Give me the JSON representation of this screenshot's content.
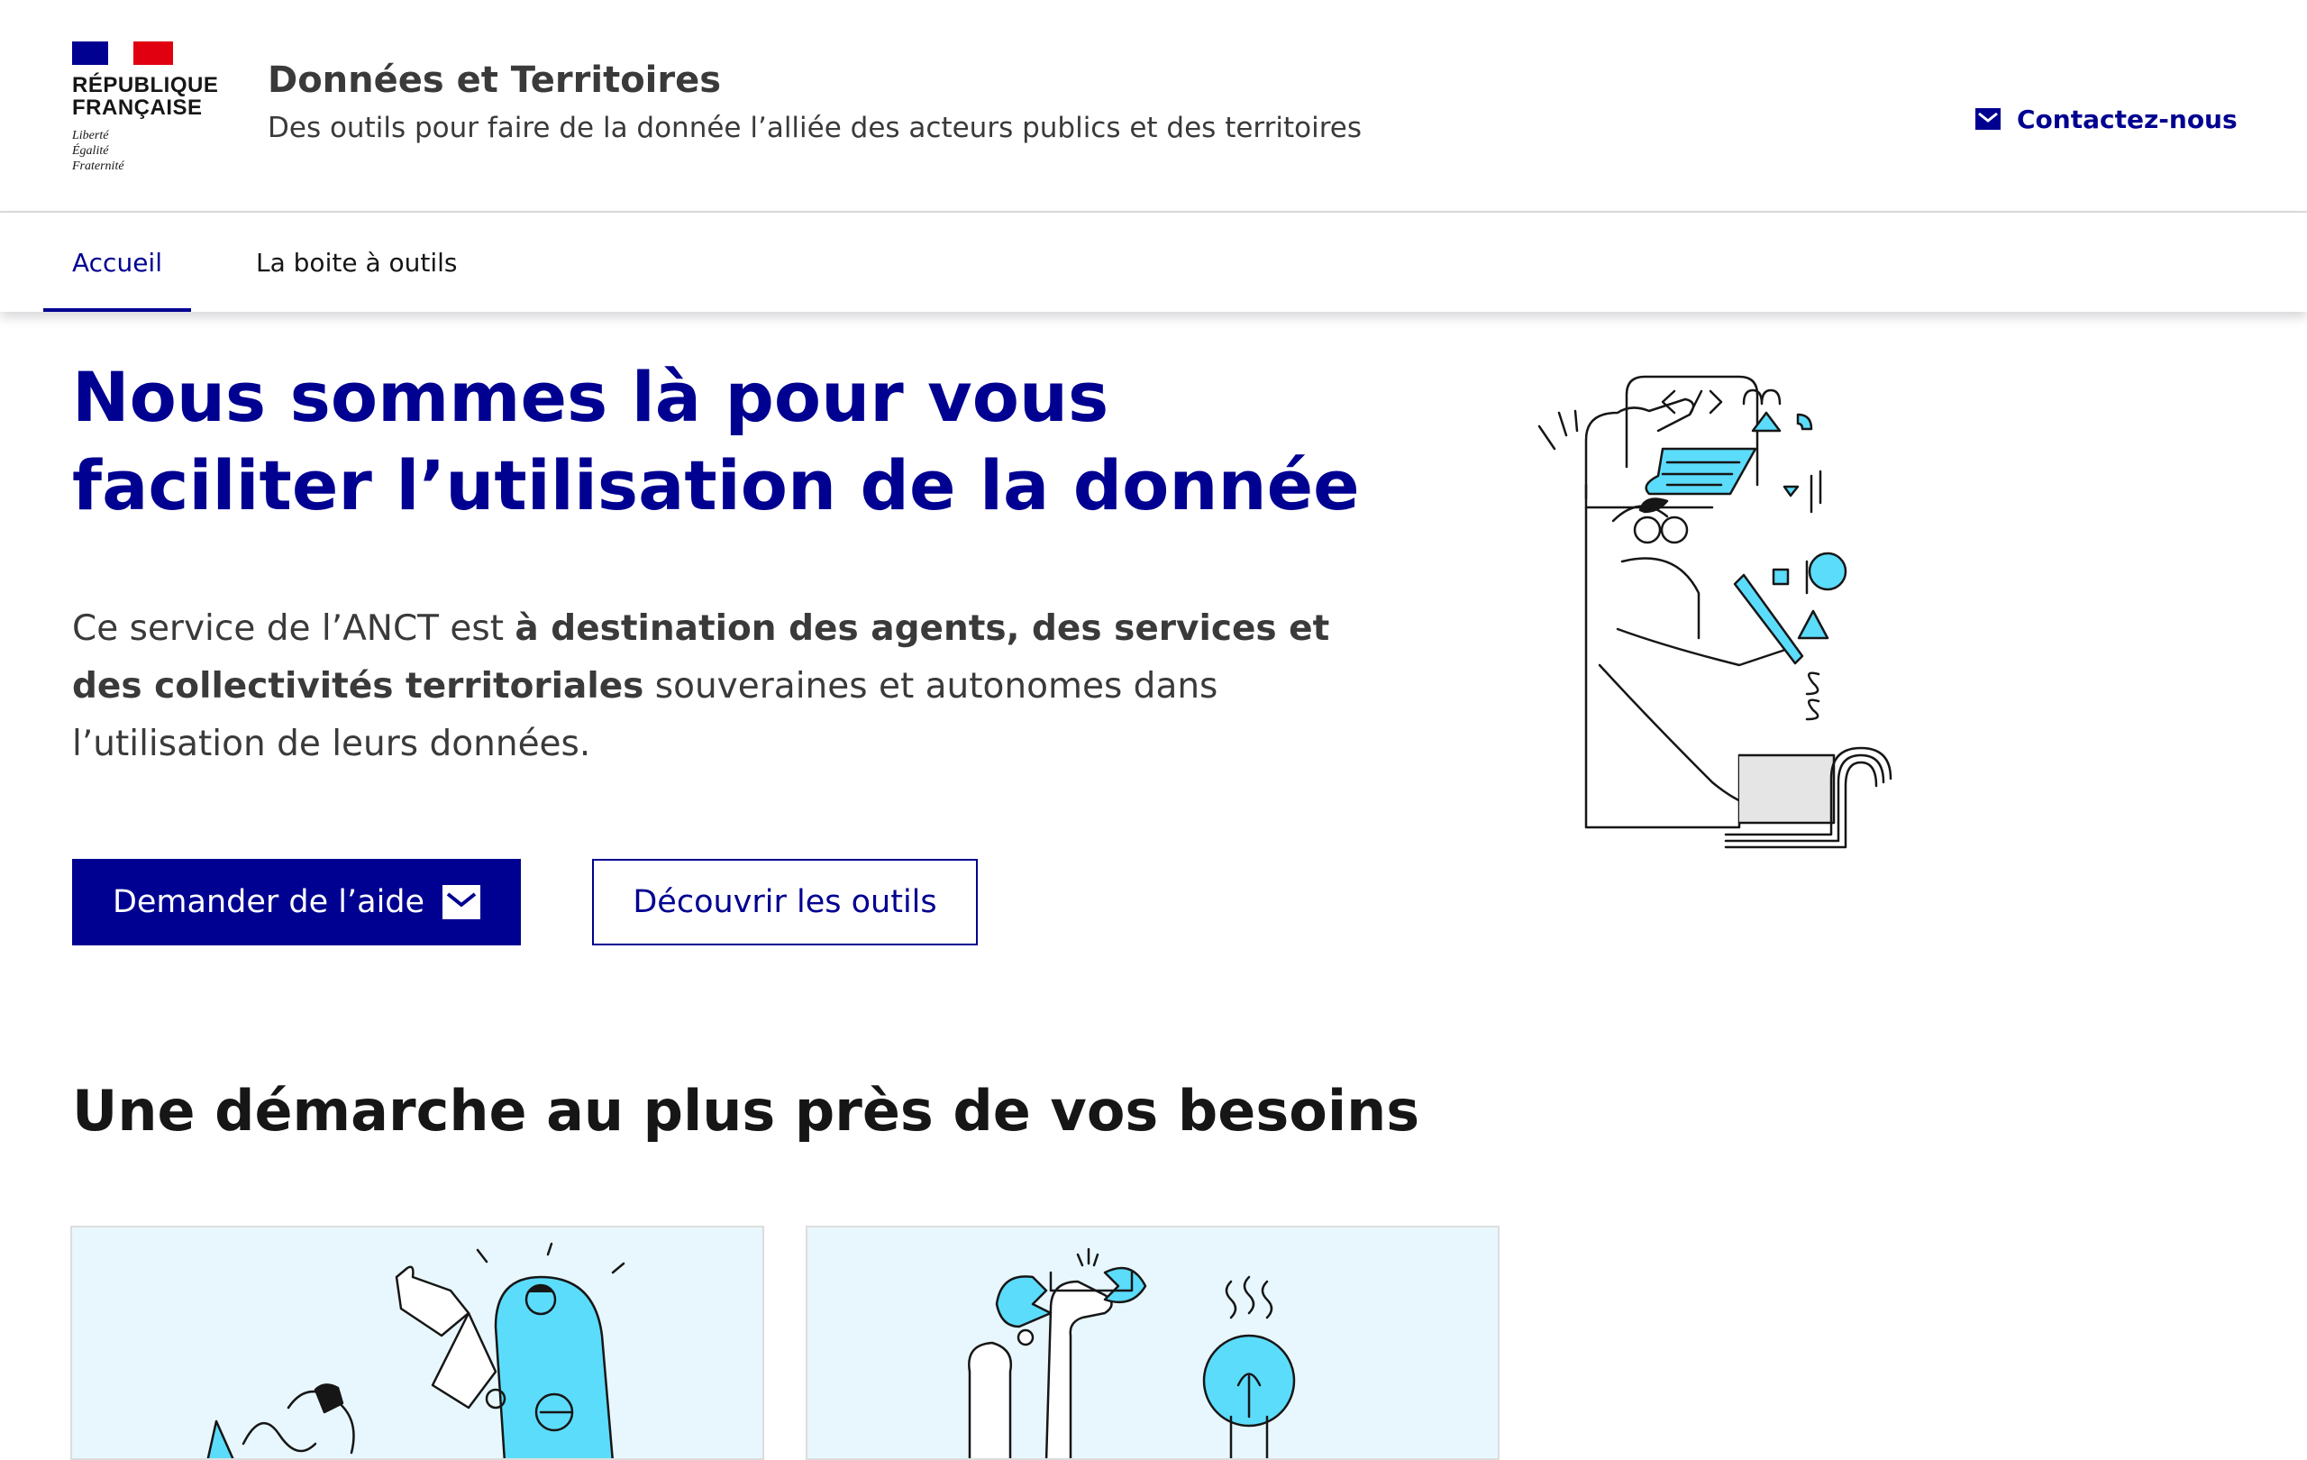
{
  "header": {
    "logo": {
      "line1": "RÉPUBLIQUE",
      "line2": "FRANÇAISE",
      "motto1": "Liberté",
      "motto2": "Égalité",
      "motto3": "Fraternité"
    },
    "service_title": "Données et Territoires",
    "service_tagline": "Des outils pour faire de la donnée l’alliée des acteurs publics et des territoires",
    "contact_label": "Contactez-nous",
    "contact_icon": "mail-icon"
  },
  "nav": {
    "items": [
      {
        "label": "Accueil",
        "active": true
      },
      {
        "label": "La boite à outils",
        "active": false
      }
    ]
  },
  "hero": {
    "title": "Nous sommes là pour vous faciliter l’utilisation de la donnée",
    "desc_part1": "Ce service de l’ANCT est ",
    "desc_strong": "à destination des agents, des services et des collectivités territoriales",
    "desc_part2": " souveraines et autonomes dans l’utilisation de leurs données.",
    "primary_button": "Demander de l’aide",
    "primary_button_icon": "mail-icon",
    "secondary_button": "Découvrir les outils",
    "illustration": "person-drawing-data-illustration"
  },
  "section": {
    "title": "Une démarche au plus près de vos besoins",
    "cards": [
      {
        "illustration": "team-collaboration-illustration"
      },
      {
        "illustration": "tools-lightbulb-illustration"
      }
    ]
  },
  "colors": {
    "primary": "#000091",
    "flag_red": "#e1000f",
    "illustration_blue": "#5cdcfb",
    "card_bg": "#e8f7fd",
    "text": "#161616",
    "text_secondary": "#3a3a3a"
  }
}
